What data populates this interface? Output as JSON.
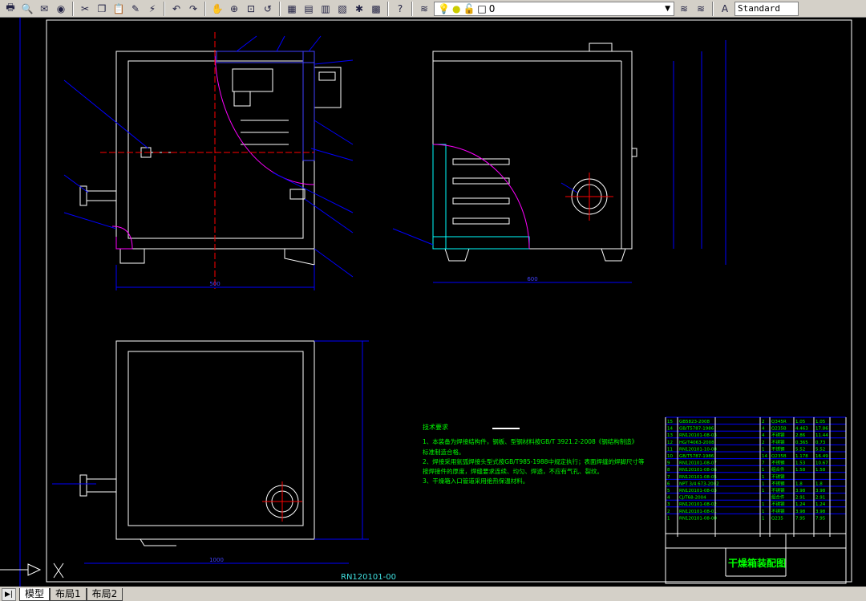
{
  "toolbar": {
    "icons": [
      "plot-icon",
      "plot-preview-icon",
      "publish-icon",
      "etransmit-icon",
      "cut-icon",
      "copy-icon",
      "paste-icon",
      "match-properties-icon",
      "block-editor-icon",
      "undo-icon",
      "redo-icon",
      "pan-icon",
      "zoom-realtime-icon",
      "zoom-window-icon",
      "zoom-previous-icon",
      "properties-icon",
      "design-center-icon",
      "tool-palettes-icon",
      "sheet-set-icon",
      "markup-icon",
      "calculator-icon",
      "help-icon"
    ],
    "layer_value": "0",
    "text_style": "Standard"
  },
  "tabs": [
    "模型",
    "布局1",
    "布局2"
  ],
  "active_tab": "模型",
  "drawing": {
    "tech_title": "技术要求",
    "tech_notes": [
      "1、本装备为焊接结构件，钢板、型钢材料按GB/T 3921.2-2008《钢结构制造》",
      "标准制造合格。",
      "2、焊接采用氩弧焊接头型式按GB/T985-1988中规定执行；表面焊缝的焊脚尺寸等",
      "按焊接件的厚度，焊缝要求连续、均匀、焊透，不应有气孔、裂纹。",
      "3、干燥箱入口管道采用绝热保温材料。"
    ],
    "drawing_number": "RN120101-00",
    "title": "干燥箱装配图",
    "dims": {
      "front_width": "500",
      "side_width": "600",
      "top_width": "1000"
    },
    "parts": [
      [
        "15",
        "GB5823-2008",
        "",
        "2",
        "Q345R",
        "1.05",
        "1.05"
      ],
      [
        "14",
        "GB/T5787-1986",
        "",
        "4",
        "Q235B",
        "4.463",
        "17.86"
      ],
      [
        "13",
        "RN120101-08-03",
        "",
        "4",
        "不锈钢",
        "2.86",
        "11.44"
      ],
      [
        "12",
        "HG/T4063-2008",
        "",
        "2",
        "不锈钢",
        "0.365",
        "0.73"
      ],
      [
        "11",
        "RN120101-10-08",
        "",
        "1",
        "不锈钢",
        "5.52",
        "5.52"
      ],
      [
        "10",
        "GB/T5787-1986",
        "",
        "14",
        "Q235B",
        "1.178",
        "16.49"
      ],
      [
        "9",
        "RN120101-08-07",
        "",
        "7",
        "不锈钢",
        "1.53",
        "10.67"
      ],
      [
        "8",
        "RN120101-08-06",
        "",
        "1",
        "组合件",
        "1.58",
        "1.58"
      ],
      [
        "7",
        "RN120101-08-05",
        "",
        "1",
        "不锈钢",
        "",
        ""
      ],
      [
        "6",
        "NPT 3/4 673-2002",
        "",
        "1",
        "不锈钢",
        "1.8",
        "1.8"
      ],
      [
        "5",
        "RN120101-08-03",
        "",
        "1",
        "不锈钢",
        "3.98",
        "3.98"
      ],
      [
        "4",
        "CJ/T68-2004",
        "",
        "",
        "组合件",
        "2.91",
        "2.91"
      ],
      [
        "3",
        "RN120101-08-02",
        "",
        "1",
        "不锈钢",
        "1.24",
        "1.24"
      ],
      [
        "2",
        "RN120101-08-01",
        "",
        "1",
        "不锈钢",
        "3.98",
        "3.98"
      ],
      [
        "1",
        "RN120101-08-00",
        "",
        "1",
        "Q235",
        "7.95",
        "7.95"
      ]
    ]
  },
  "colors": {
    "background": "#000000",
    "outline": "#ffffff",
    "dimension": "#0000ff",
    "centerline": "#ff0000",
    "text": "#00ff00",
    "hatch": "#00ffff",
    "arc": "#ff00ff"
  }
}
